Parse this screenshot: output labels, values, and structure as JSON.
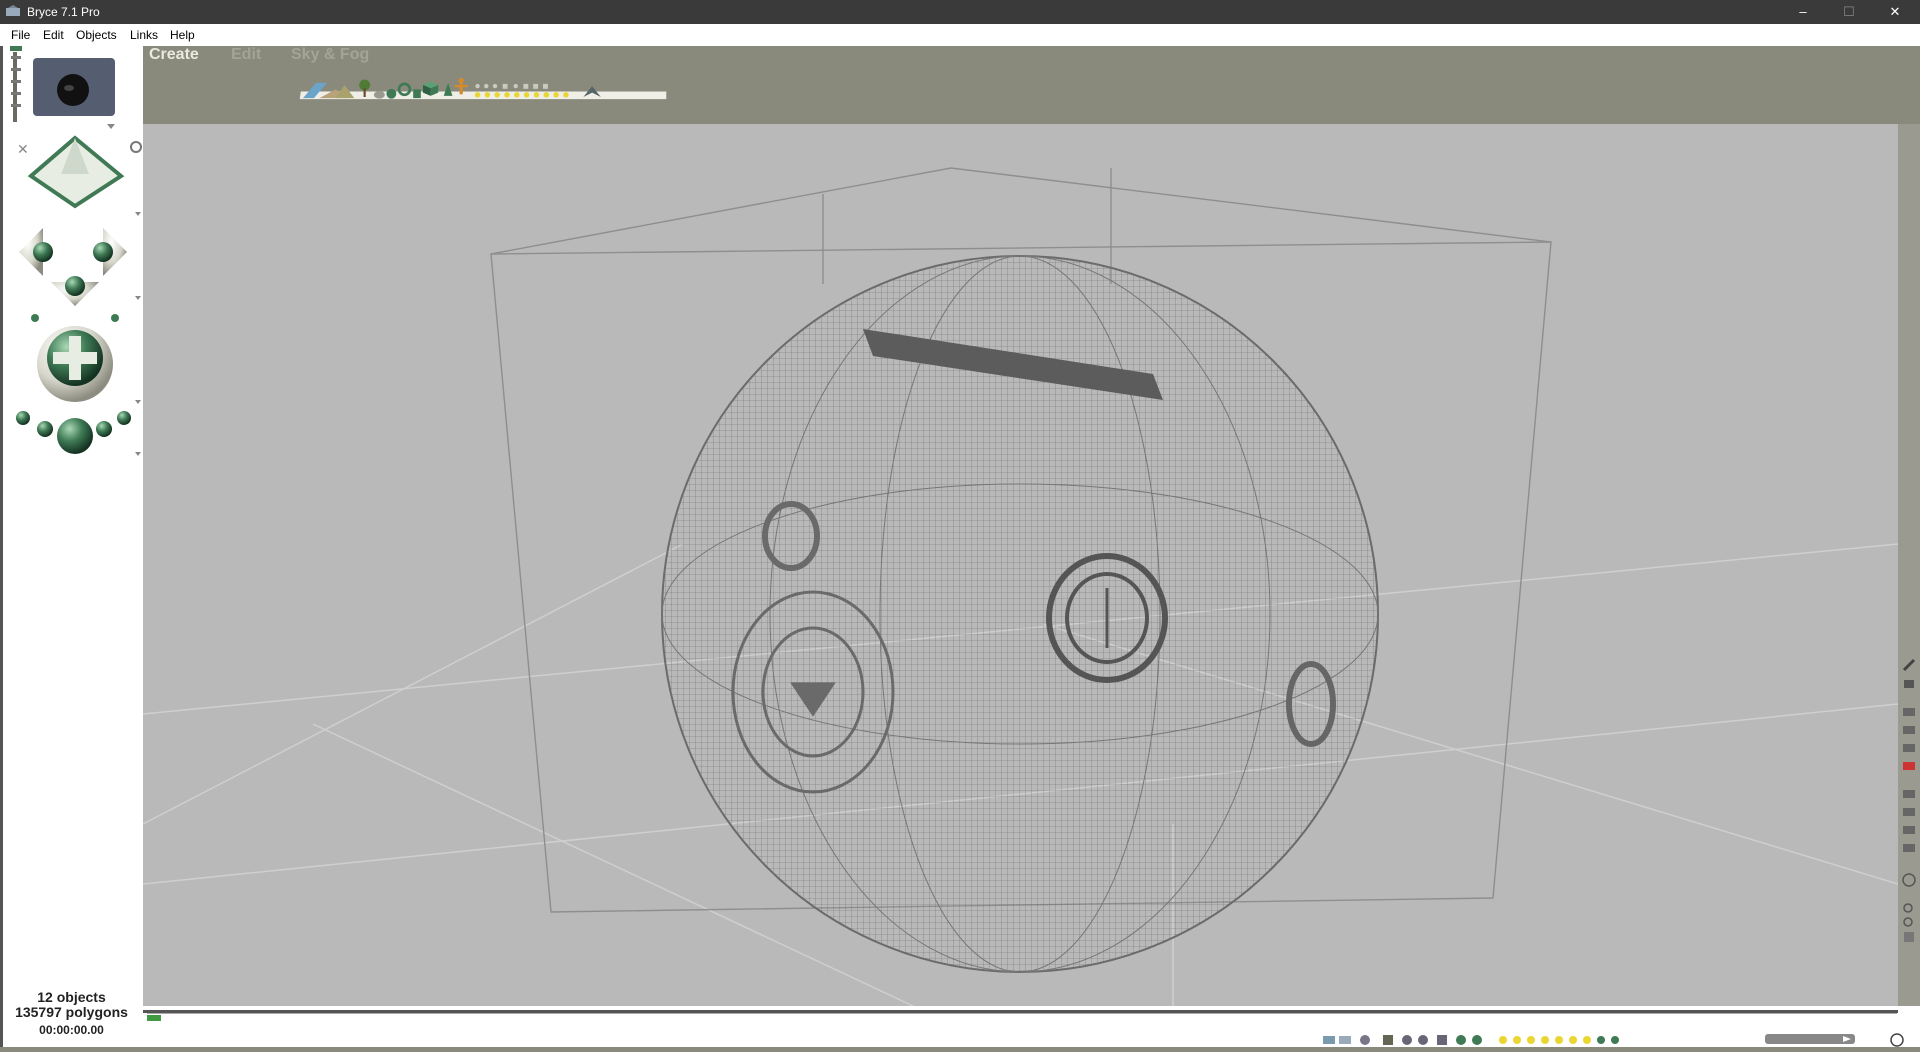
{
  "window": {
    "title": "Bryce 7.1  Pro",
    "minimize_glyph": "–",
    "maximize_glyph": "☐",
    "close_glyph": "✕"
  },
  "menu": {
    "items": [
      "File",
      "Edit",
      "Objects",
      "Links",
      "Help"
    ]
  },
  "tabs": {
    "create": "Create",
    "edit": "Edit",
    "sky_fog": "Sky & Fog"
  },
  "status": {
    "objects": "12 objects",
    "polygons": "135797 polygons",
    "time": "00:00:00.00"
  },
  "colors": {
    "window_bg": "#8a8a7c",
    "viewport_bg": "#b9b9b9",
    "accent_green": "#3f7a55",
    "wire": "#6b6b6b",
    "icon_yellow": "#e9d630"
  },
  "icons": [
    "brycecamera-icon",
    "preview-thumbnail-icon",
    "camera-trackball-icon",
    "pan-arrows-icon",
    "zoom-orb-icon",
    "terrain-icon",
    "tree-icon",
    "rock-icon",
    "sphere-icon",
    "torus-icon",
    "cube-icon",
    "cone-icon",
    "figure-icon",
    "light-icon",
    "play-icon",
    "globe-icon"
  ]
}
